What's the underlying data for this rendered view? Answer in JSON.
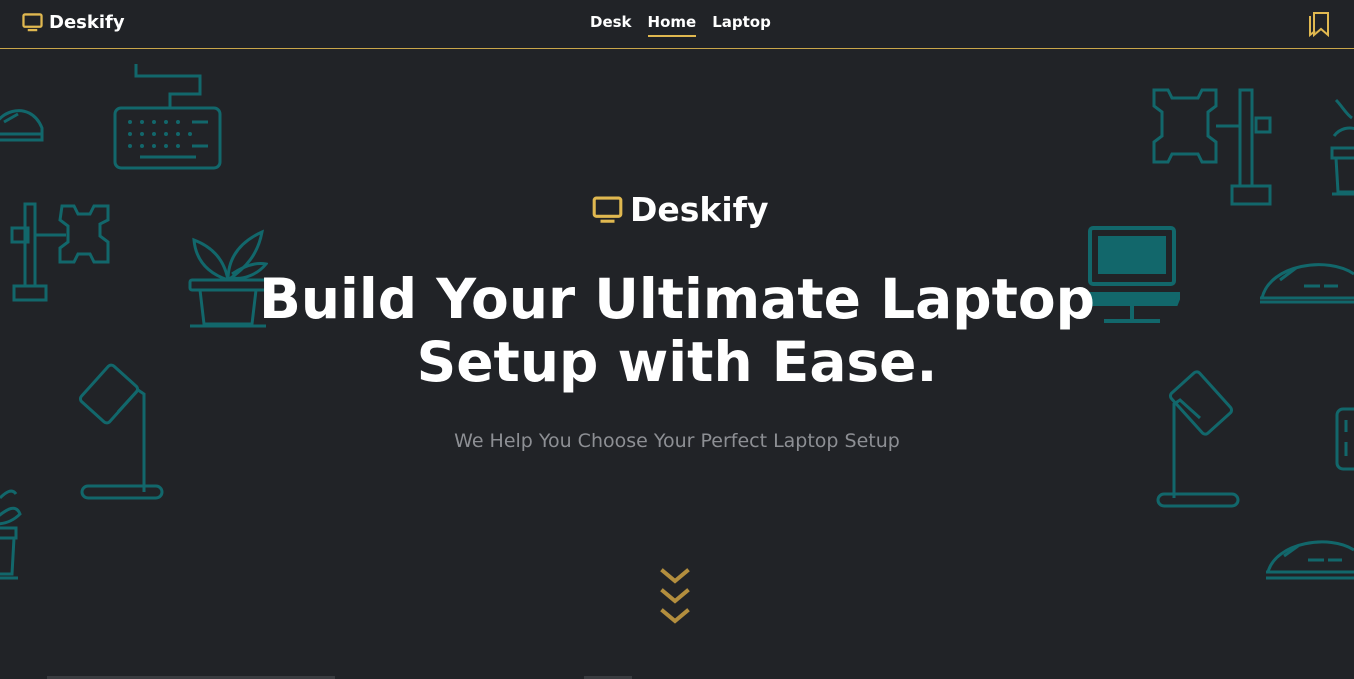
{
  "nav": {
    "brand": "Deskify",
    "links": [
      {
        "label": "Desk",
        "active": false
      },
      {
        "label": "Home",
        "active": true
      },
      {
        "label": "Laptop",
        "active": false
      }
    ],
    "bookmark_icon": "bookmarks-icon"
  },
  "hero": {
    "logo_text": "Deskify",
    "title_line1": "Build Your Ultimate Laptop",
    "title_line2": "Setup with Ease.",
    "subtitle": "We Help You Choose Your Perfect Laptop Setup",
    "scroll_icon": "chevrons-down-icon"
  },
  "colors": {
    "background": "#212327",
    "accent": "#e0b850",
    "decor": "#12676b",
    "text": "#ffffff",
    "muted": "#8d8f94"
  }
}
